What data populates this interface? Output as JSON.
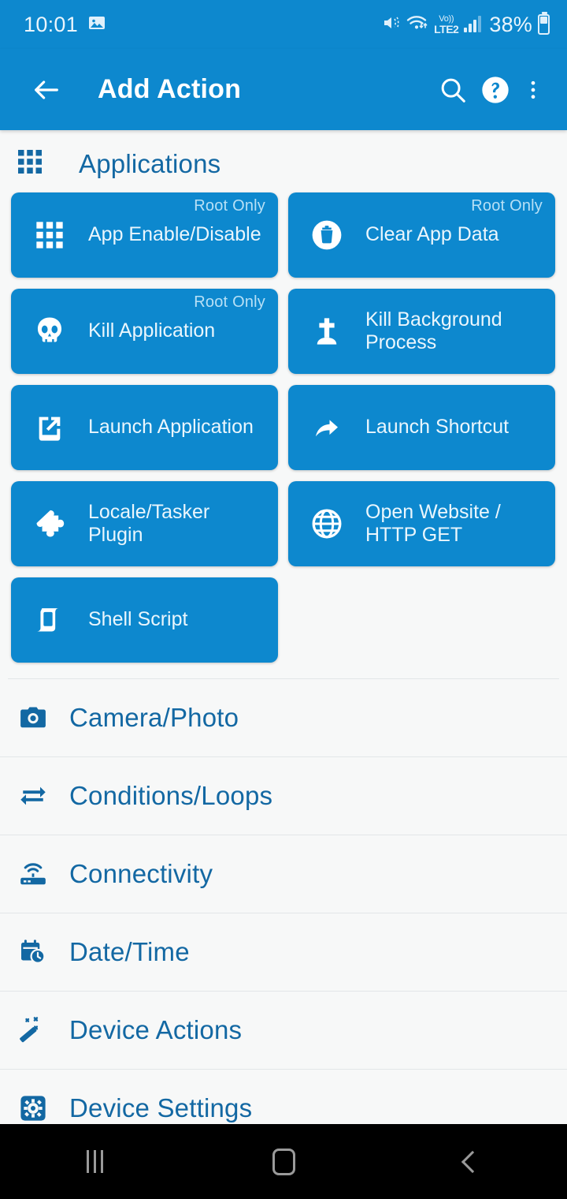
{
  "status_bar": {
    "clock": "10:01",
    "battery_percent": "38%",
    "volte_top": "Vo))",
    "volte_bottom": "LTE2",
    "icons": [
      "image-icon",
      "mute-vibrate-icon",
      "wifi-icon",
      "volte-icon",
      "signal-bars-icon",
      "battery-icon"
    ]
  },
  "app_bar": {
    "title": "Add Action",
    "back_icon": "back-arrow-icon",
    "search_icon": "search-icon",
    "help_icon": "help-icon",
    "overflow_icon": "overflow-menu-icon"
  },
  "colors": {
    "accent": "#0d88ce",
    "text_blue": "#1368a3",
    "card_bg": "#0d88ce",
    "card_text": "#eaf6fd",
    "badge_text": "#b7e0f6",
    "page_bg": "#f7f8f8",
    "divider": "#e2e6e8",
    "navbar_bg": "#000000"
  },
  "section": {
    "title": "Applications",
    "icon": "apps-grid-icon",
    "cards": [
      {
        "label": "App Enable/Disable",
        "badge": "Root Only",
        "icon": "apps-grid-icon"
      },
      {
        "label": "Clear App Data",
        "badge": "Root Only",
        "icon": "delete-circle-icon"
      },
      {
        "label": "Kill Application",
        "badge": "Root Only",
        "icon": "skull-icon"
      },
      {
        "label": "Kill Background Process",
        "badge": "",
        "icon": "grave-cross-icon"
      },
      {
        "label": "Launch Application",
        "badge": "",
        "icon": "open-in-new-icon"
      },
      {
        "label": "Launch Shortcut",
        "badge": "",
        "icon": "share-arrow-icon"
      },
      {
        "label": "Locale/Tasker Plugin",
        "badge": "",
        "icon": "puzzle-piece-icon"
      },
      {
        "label": "Open Website / HTTP GET",
        "badge": "",
        "icon": "globe-icon"
      },
      {
        "label": "Shell Script",
        "badge": "",
        "icon": "scroll-icon"
      }
    ]
  },
  "categories": [
    {
      "label": "Camera/Photo",
      "icon": "camera-icon"
    },
    {
      "label": "Conditions/Loops",
      "icon": "loop-repeat-icon"
    },
    {
      "label": "Connectivity",
      "icon": "router-icon"
    },
    {
      "label": "Date/Time",
      "icon": "calendar-clock-icon"
    },
    {
      "label": "Device Actions",
      "icon": "magic-wand-icon"
    },
    {
      "label": "Device Settings",
      "icon": "gear-square-icon"
    }
  ],
  "nav_bar": {
    "recents_label": "recents-icon",
    "home_label": "home-icon",
    "back_label": "back-icon"
  }
}
